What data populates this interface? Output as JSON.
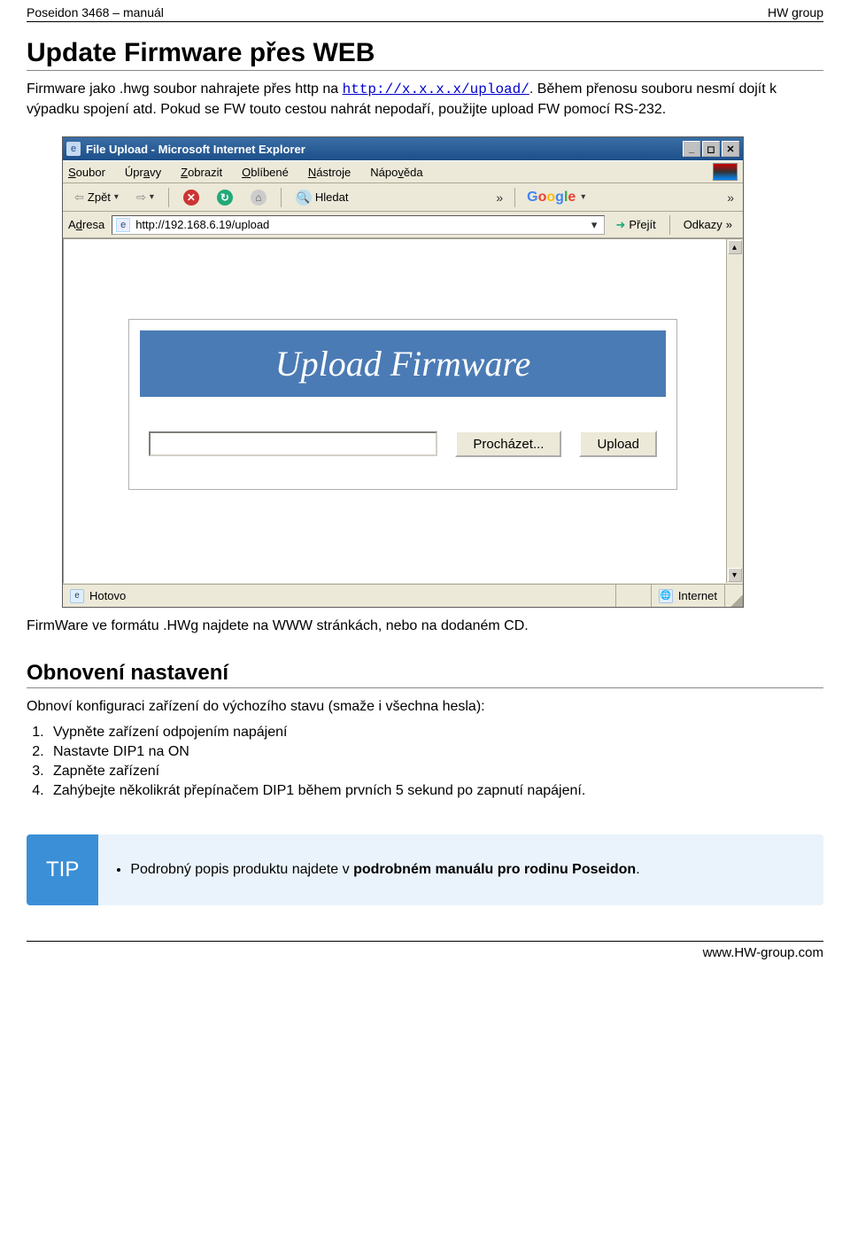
{
  "header": {
    "left": "Poseidon 3468 – manuál",
    "right": "HW group"
  },
  "h1": "Update Firmware přes WEB",
  "p1_pre": "Firmware jako .hwg soubor nahrajete přes http na ",
  "p1_link": "http://x.x.x.x/upload/",
  "p1_post": ". Během přenosu souboru nesmí dojít k výpadku spojení atd. Pokud se FW touto cestou nahrát nepodaří, použijte upload FW pomocí RS-232.",
  "ie": {
    "title": "File Upload - Microsoft Internet Explorer",
    "menu": {
      "soubor": "Soubor",
      "upravy": "Úpravy",
      "zobrazit": "Zobrazit",
      "oblibene": "Oblíbené",
      "nastroje": "Nástroje",
      "napoveda": "Nápověda"
    },
    "toolbar": {
      "back": "Zpět",
      "search": "Hledat",
      "google": "Google",
      "chev": "»"
    },
    "address": {
      "label": "Adresa",
      "url": "http://192.168.6.19/upload",
      "go": "Přejít",
      "links": "Odkazy"
    },
    "upload": {
      "title": "Upload Firmware",
      "browse": "Procházet...",
      "upload": "Upload"
    },
    "status": {
      "done": "Hotovo",
      "zone": "Internet"
    }
  },
  "p2": "FirmWare ve formátu .HWg najdete na WWW stránkách, nebo na dodaném CD.",
  "h2": "Obnovení nastavení",
  "p3": "Obnoví konfiguraci zařízení do výchozího stavu (smaže i všechna hesla):",
  "steps": {
    "s1": "Vypněte zařízení odpojením napájení",
    "s2": "Nastavte DIP1 na ON",
    "s3": "Zapněte zařízení",
    "s4": "Zahýbejte několikrát přepínačem DIP1 během prvních 5 sekund po zapnutí napájení."
  },
  "tip": {
    "label": "TIP",
    "text_pre": "Podrobný popis produktu najdete v ",
    "text_strong": "podrobném manuálu pro rodinu Poseidon",
    "text_post": "."
  },
  "footer": "www.HW-group.com"
}
